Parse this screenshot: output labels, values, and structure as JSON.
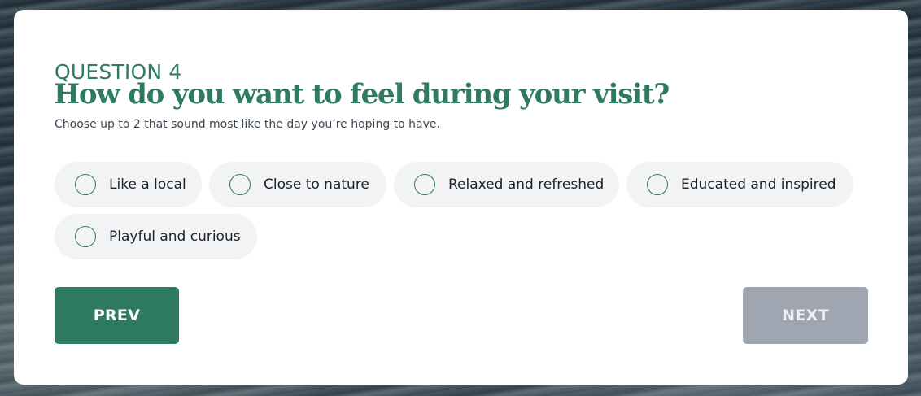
{
  "question": {
    "eyebrow": "QUESTION 4",
    "title": "How do you want to feel during your visit?",
    "subtitle": "Choose up to 2 that sound most like the day you’re hoping to have."
  },
  "options": [
    {
      "label": "Like a local",
      "selected": false
    },
    {
      "label": "Close to nature",
      "selected": false
    },
    {
      "label": "Relaxed and refreshed",
      "selected": false
    },
    {
      "label": "Educated and inspired",
      "selected": false
    },
    {
      "label": "Playful and curious",
      "selected": false
    }
  ],
  "nav": {
    "prev_label": "PREV",
    "next_label": "NEXT",
    "next_enabled": false
  },
  "colors": {
    "accent": "#2e7a62",
    "pill_bg": "#f2f3f4",
    "disabled_button": "#a0a5b2"
  }
}
